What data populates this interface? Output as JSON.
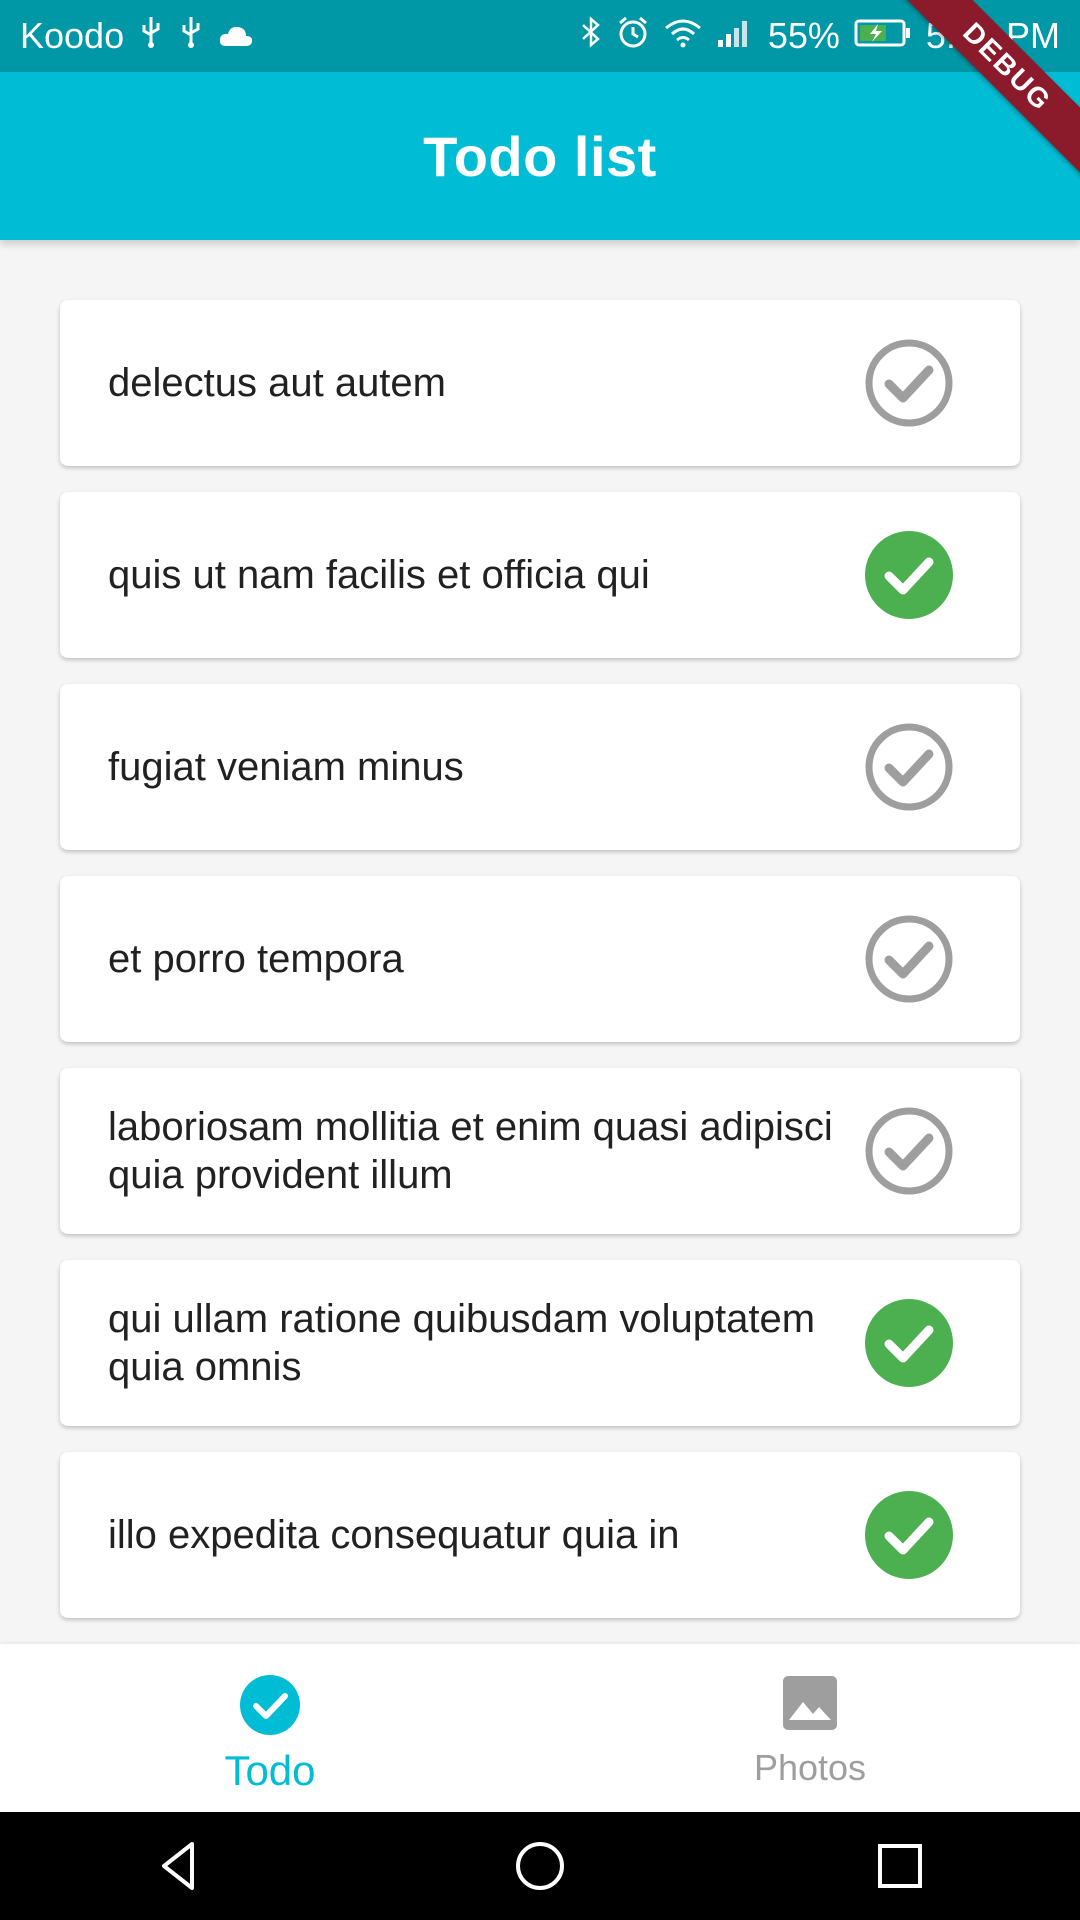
{
  "status_bar": {
    "carrier": "Koodo",
    "battery": "55%",
    "time": "5:18 PM"
  },
  "app_bar": {
    "title": "Todo list"
  },
  "debug_label": "DEBUG",
  "todos": [
    {
      "title": "delectus aut autem",
      "completed": false
    },
    {
      "title": "quis ut nam facilis et officia qui",
      "completed": true
    },
    {
      "title": "fugiat veniam minus",
      "completed": false
    },
    {
      "title": "et porro tempora",
      "completed": false
    },
    {
      "title": "laboriosam mollitia et enim quasi adipisci quia provident illum",
      "completed": false
    },
    {
      "title": "qui ullam ratione quibusdam voluptatem quia omnis",
      "completed": true
    },
    {
      "title": "illo expedita consequatur quia in",
      "completed": true
    }
  ],
  "bottom_nav": {
    "todo_label": "Todo",
    "photos_label": "Photos"
  },
  "colors": {
    "primary": "#00bcd4",
    "status_bar": "#0097a7",
    "done": "#4caf50",
    "pending": "#9e9e9e"
  }
}
